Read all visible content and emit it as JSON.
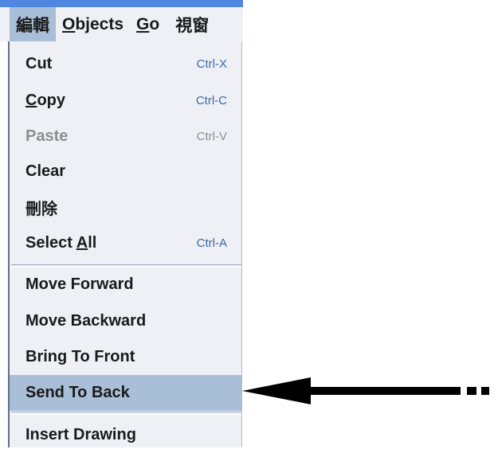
{
  "menubar": {
    "menus": [
      {
        "label": "編輯"
      },
      {
        "label_plain": "bjects",
        "underline": "O"
      },
      {
        "label_plain": "o",
        "underline": "G"
      },
      {
        "label": "視窗"
      }
    ]
  },
  "dropdown": {
    "items": [
      {
        "label": "Cut",
        "shortcut": "Ctrl-X",
        "enabled": true
      },
      {
        "label_plain": "opy",
        "underline": "C",
        "shortcut": "Ctrl-C",
        "enabled": true
      },
      {
        "label": "Paste",
        "shortcut": "Ctrl-V",
        "enabled": false
      },
      {
        "label": "Clear",
        "shortcut": "",
        "enabled": true
      },
      {
        "label": "刪除",
        "shortcut": "",
        "enabled": true
      },
      {
        "label_prefix": "Select ",
        "underline": "A",
        "label_suffix": "ll",
        "shortcut": "Ctrl-A",
        "enabled": true
      },
      {
        "label": "Move Forward",
        "enabled": true
      },
      {
        "label": "Move Backward",
        "enabled": true
      },
      {
        "label": "Bring To Front",
        "enabled": true
      },
      {
        "label": "Send To Back",
        "enabled": true,
        "selected": true
      },
      {
        "label": "Insert Drawing",
        "enabled": true
      }
    ]
  },
  "colors": {
    "menubar_bg": "#eef0f5",
    "selected_bg": "#a9bed7",
    "shortcut": "#3d67a8",
    "disabled": "#8e8e8e",
    "arrow": "#000000"
  },
  "annotation": {
    "arrow_icon": "left-arrow-icon"
  }
}
